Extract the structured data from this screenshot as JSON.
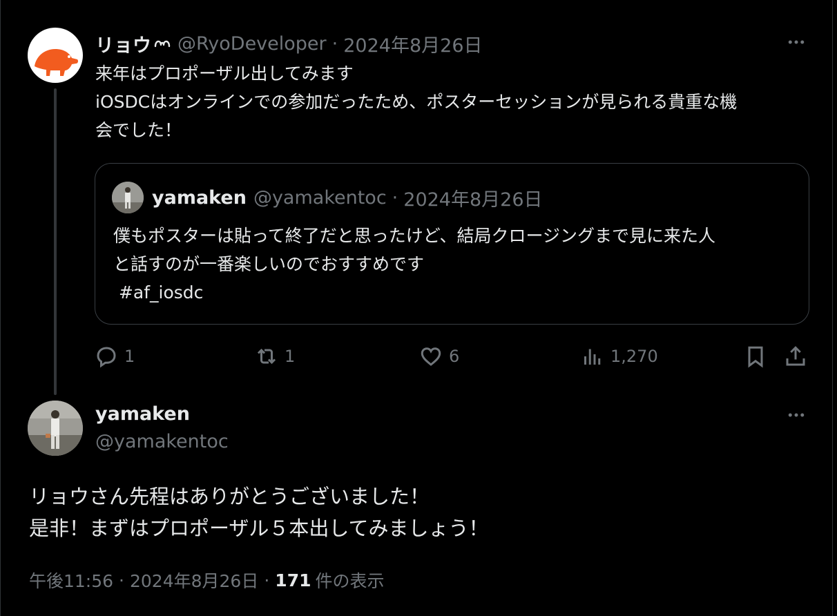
{
  "tweet1": {
    "author_name": "リョウ",
    "author_handle": "@RyoDeveloper",
    "sep": "·",
    "date": "2024年8月26日",
    "lines": [
      "来年はプロポーザル出してみます",
      "iOSDCはオンラインでの参加だったため、ポスターセッションが見られる貴重な機",
      "会でした！"
    ],
    "quote": {
      "author_name": "yamaken",
      "author_handle": "@yamakentoc",
      "sep": "·",
      "date": "2024年8月26日",
      "lines": [
        "僕もポスターは貼って終了だと思ったけど、結局クロージングまで見に来た人",
        "と話すのが一番楽しいのでおすすめです",
        " #af_iosdc"
      ]
    },
    "actions": {
      "reply_count": "1",
      "repost_count": "1",
      "like_count": "6",
      "view_count": "1,270"
    }
  },
  "tweet2": {
    "author_name": "yamaken",
    "author_handle": "@yamakentoc",
    "lines": [
      "リョウさん先程はありがとうございました！",
      "是非！まずはプロポーザル５本出してみましょう！"
    ],
    "time": "午後11:56",
    "sep1": "·",
    "date": "2024年8月26日",
    "sep2": "·",
    "view_count": "171",
    "view_label": "件の表示"
  },
  "icons": [
    "more-icon",
    "reply-icon",
    "repost-icon",
    "like-icon",
    "views-icon",
    "bookmark-icon",
    "share-icon",
    "glasses-icon"
  ]
}
